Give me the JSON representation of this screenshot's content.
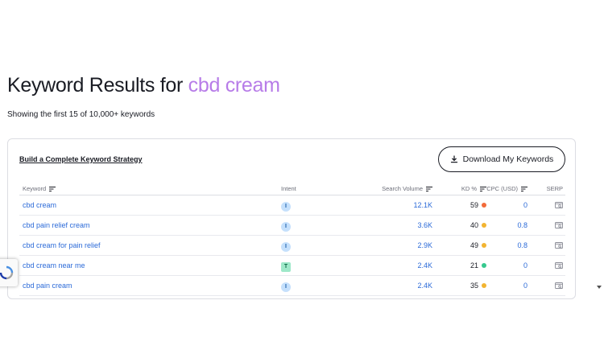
{
  "header": {
    "title_prefix": "Keyword Results for",
    "query": "cbd cream",
    "subtitle": "Showing the first 15 of 10,000+ keywords"
  },
  "card": {
    "strategy_link": "Build a Complete Keyword Strategy",
    "download_label": "Download My Keywords"
  },
  "table": {
    "columns": {
      "keyword": "Keyword",
      "intent": "Intent",
      "volume": "Search Volume",
      "kd": "KD %",
      "cpc": "CPC (USD)",
      "serp": "SERP"
    },
    "rows": [
      {
        "keyword": "cbd cream",
        "intent": "I",
        "volume": "12.1K",
        "kd": "59",
        "kd_color": "#f26b3a",
        "cpc": "0"
      },
      {
        "keyword": "cbd pain relief cream",
        "intent": "I",
        "volume": "3.6K",
        "kd": "40",
        "kd_color": "#f2b431",
        "cpc": "0.8"
      },
      {
        "keyword": "cbd cream for pain relief",
        "intent": "I",
        "volume": "2.9K",
        "kd": "49",
        "kd_color": "#f2b431",
        "cpc": "0.8"
      },
      {
        "keyword": "cbd cream near me",
        "intent": "T",
        "volume": "2.4K",
        "kd": "21",
        "kd_color": "#36c98e",
        "cpc": "0"
      },
      {
        "keyword": "cbd pain cream",
        "intent": "I",
        "volume": "2.4K",
        "kd": "35",
        "kd_color": "#f2b431",
        "cpc": "0"
      }
    ]
  },
  "icons": {
    "download": "download-icon",
    "sort": "sort-icon",
    "serp": "serp-icon",
    "recaptcha": "recaptcha-icon"
  },
  "colors": {
    "query_accent": "#b77ce8",
    "link_blue": "#2b6ad8",
    "kd_hard": "#f26b3a",
    "kd_medium": "#f2b431",
    "kd_easy": "#36c98e"
  }
}
